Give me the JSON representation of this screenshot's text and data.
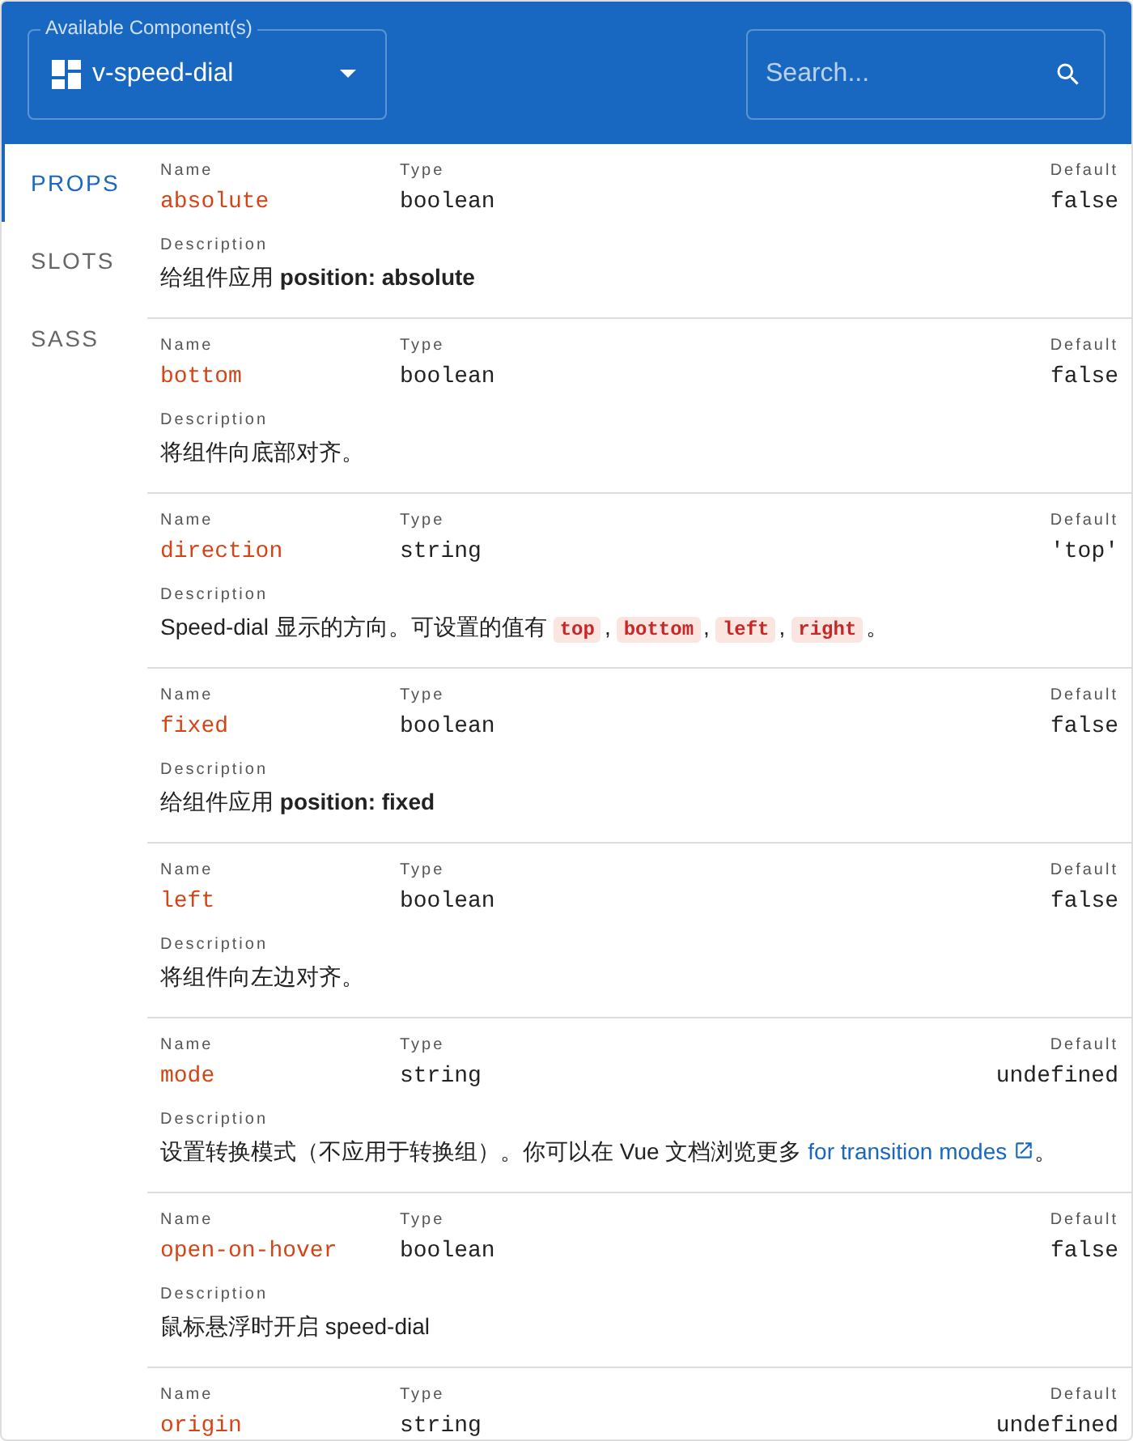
{
  "header": {
    "component_select": {
      "label": "Available Component(s)",
      "value": "v-speed-dial"
    },
    "search": {
      "placeholder": "Search..."
    }
  },
  "tabs": [
    {
      "label": "PROPS",
      "selected": true
    },
    {
      "label": "SLOTS",
      "selected": false
    },
    {
      "label": "SASS",
      "selected": false
    }
  ],
  "props": [
    {
      "name_label": "Name",
      "name": "absolute",
      "type_label": "Type",
      "type": "boolean",
      "default_label": "Default",
      "default": "false",
      "description_label": "Description",
      "description": [
        {
          "kind": "text",
          "text": "给组件应用 **position: absolute**"
        }
      ]
    },
    {
      "name_label": "Name",
      "name": "bottom",
      "type_label": "Type",
      "type": "boolean",
      "default_label": "Default",
      "default": "false",
      "description_label": "Description",
      "description": [
        {
          "kind": "text",
          "text": "将组件向底部对齐。"
        }
      ]
    },
    {
      "name_label": "Name",
      "name": "direction",
      "type_label": "Type",
      "type": "string",
      "default_label": "Default",
      "default": "'top'",
      "description_label": "Description",
      "description": [
        {
          "kind": "text",
          "text": "Speed-dial 显示的方向。可设置的值有"
        },
        {
          "kind": "code",
          "text": "top"
        },
        {
          "kind": "text",
          "text": ","
        },
        {
          "kind": "code",
          "text": "bottom"
        },
        {
          "kind": "text",
          "text": ","
        },
        {
          "kind": "code",
          "text": "left"
        },
        {
          "kind": "text",
          "text": ","
        },
        {
          "kind": "code",
          "text": "right"
        },
        {
          "kind": "text",
          "text": "。"
        }
      ]
    },
    {
      "name_label": "Name",
      "name": "fixed",
      "type_label": "Type",
      "type": "boolean",
      "default_label": "Default",
      "default": "false",
      "description_label": "Description",
      "description": [
        {
          "kind": "text",
          "text": "给组件应用 **position: fixed**"
        }
      ]
    },
    {
      "name_label": "Name",
      "name": "left",
      "type_label": "Type",
      "type": "boolean",
      "default_label": "Default",
      "default": "false",
      "description_label": "Description",
      "description": [
        {
          "kind": "text",
          "text": "将组件向左边对齐。"
        }
      ]
    },
    {
      "name_label": "Name",
      "name": "mode",
      "type_label": "Type",
      "type": "string",
      "default_label": "Default",
      "default": "undefined",
      "description_label": "Description",
      "description": [
        {
          "kind": "text",
          "text": "设置转换模式（不应用于转换组）。你可以在 Vue 文档浏览更多"
        },
        {
          "kind": "link",
          "text": "for transition modes"
        },
        {
          "kind": "text",
          "text": "。"
        }
      ]
    },
    {
      "name_label": "Name",
      "name": "open-on-hover",
      "type_label": "Type",
      "type": "boolean",
      "default_label": "Default",
      "default": "false",
      "description_label": "Description",
      "description": [
        {
          "kind": "text",
          "text": "鼠标悬浮时开启 speed-dial"
        }
      ]
    },
    {
      "name_label": "Name",
      "name": "origin",
      "type_label": "Type",
      "type": "string",
      "default_label": "Default",
      "default": "undefined"
    }
  ]
}
